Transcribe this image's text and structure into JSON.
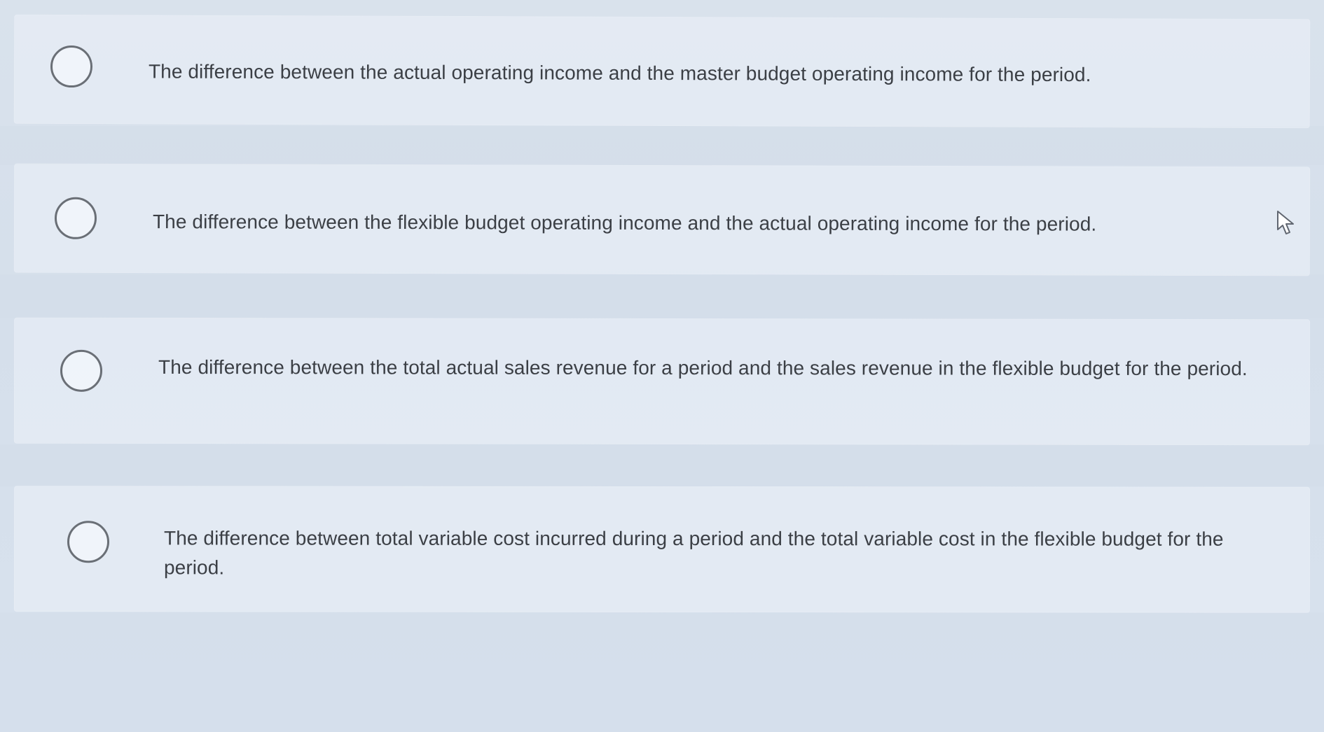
{
  "question": {
    "options": [
      {
        "label": "The difference between the actual operating income and the master budget operating income for the period.",
        "selected": false
      },
      {
        "label": "The difference between the flexible budget operating income and the actual operating income for the period.",
        "selected": false
      },
      {
        "label": "The difference between the total actual sales revenue for a period and the sales revenue in the flexible budget for the period.",
        "selected": false
      },
      {
        "label": "The difference between total variable cost incurred during a period and the total variable cost in the flexible budget for the period.",
        "selected": false
      }
    ]
  },
  "icons": {
    "cursor": "cursor-icon",
    "radio": "radio-button"
  },
  "colors": {
    "background": "#d9e2ec",
    "text": "#3b3f45",
    "radio_border": "#6a6f76"
  }
}
